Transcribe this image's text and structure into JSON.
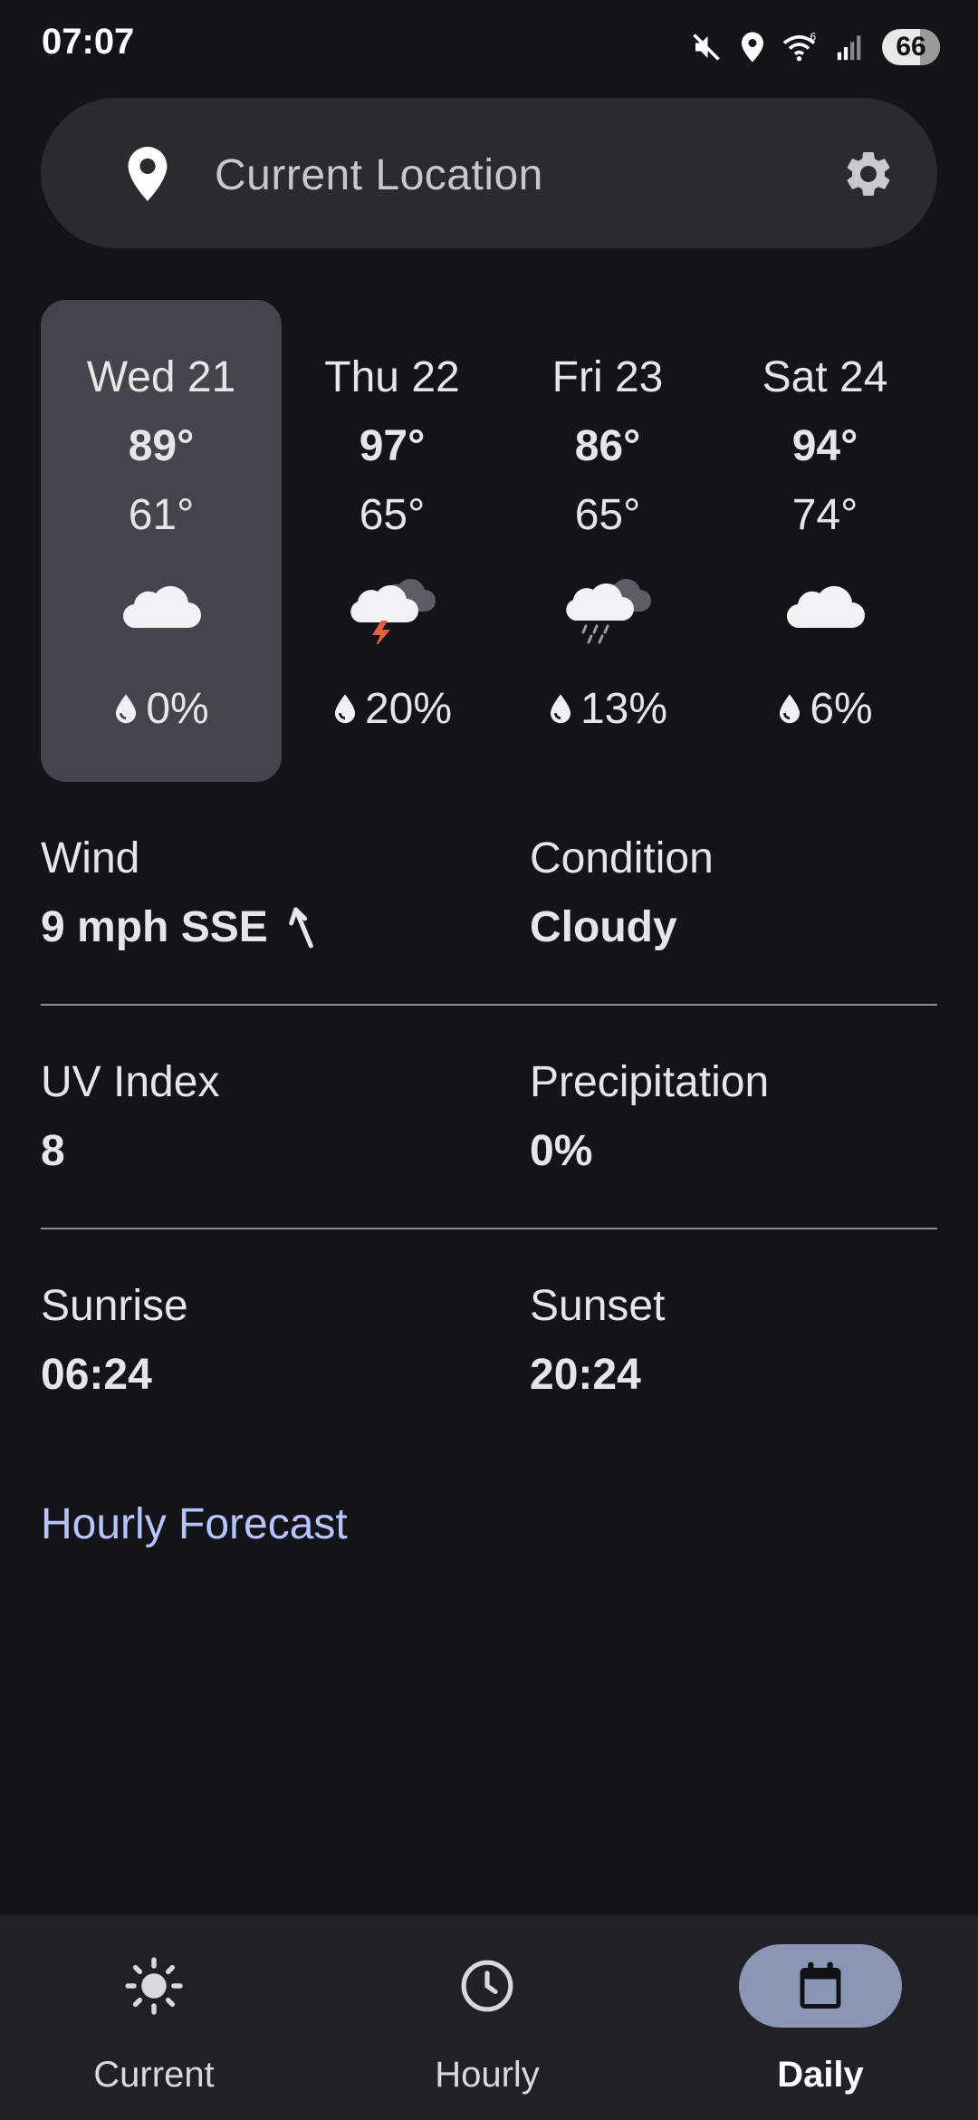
{
  "status_bar": {
    "time": "07:07",
    "battery": "66",
    "icons": [
      "mute-icon",
      "location-icon",
      "wifi-icon",
      "signal-icon",
      "battery-icon"
    ]
  },
  "location_bar": {
    "text": "Current Location",
    "icons": [
      "location-pin-icon",
      "settings-gear-icon"
    ]
  },
  "days": [
    {
      "name": "Wed 21",
      "high": "89°",
      "low": "61°",
      "icon": "cloudy-icon",
      "precip": "0%",
      "selected": true
    },
    {
      "name": "Thu 22",
      "high": "97°",
      "low": "65°",
      "icon": "thunderstorm-icon",
      "precip": "20%",
      "selected": false
    },
    {
      "name": "Fri 23",
      "high": "86°",
      "low": "65°",
      "icon": "rain-icon",
      "precip": "13%",
      "selected": false
    },
    {
      "name": "Sat 24",
      "high": "94°",
      "low": "74°",
      "icon": "cloudy-icon",
      "precip": "6%",
      "selected": false
    }
  ],
  "details": {
    "wind": {
      "label": "Wind",
      "value": "9 mph SSE",
      "icon": "wind-direction-arrow-icon"
    },
    "condition": {
      "label": "Condition",
      "value": "Cloudy"
    },
    "uv": {
      "label": "UV Index",
      "value": "8"
    },
    "precipitation": {
      "label": "Precipitation",
      "value": "0%"
    },
    "sunrise": {
      "label": "Sunrise",
      "value": "06:24"
    },
    "sunset": {
      "label": "Sunset",
      "value": "20:24"
    }
  },
  "hourly_link": "Hourly Forecast",
  "nav": [
    {
      "label": "Current",
      "icon": "sun-icon",
      "active": false
    },
    {
      "label": "Hourly",
      "icon": "clock-icon",
      "active": false
    },
    {
      "label": "Daily",
      "icon": "calendar-icon",
      "active": true
    }
  ],
  "colors": {
    "background": "#131419",
    "card_selected": "#43454d",
    "search_bar": "#2a2b31",
    "link": "#b8c4ff",
    "nav_active_pill": "#8b95b4",
    "lightning": "#e8603c"
  }
}
